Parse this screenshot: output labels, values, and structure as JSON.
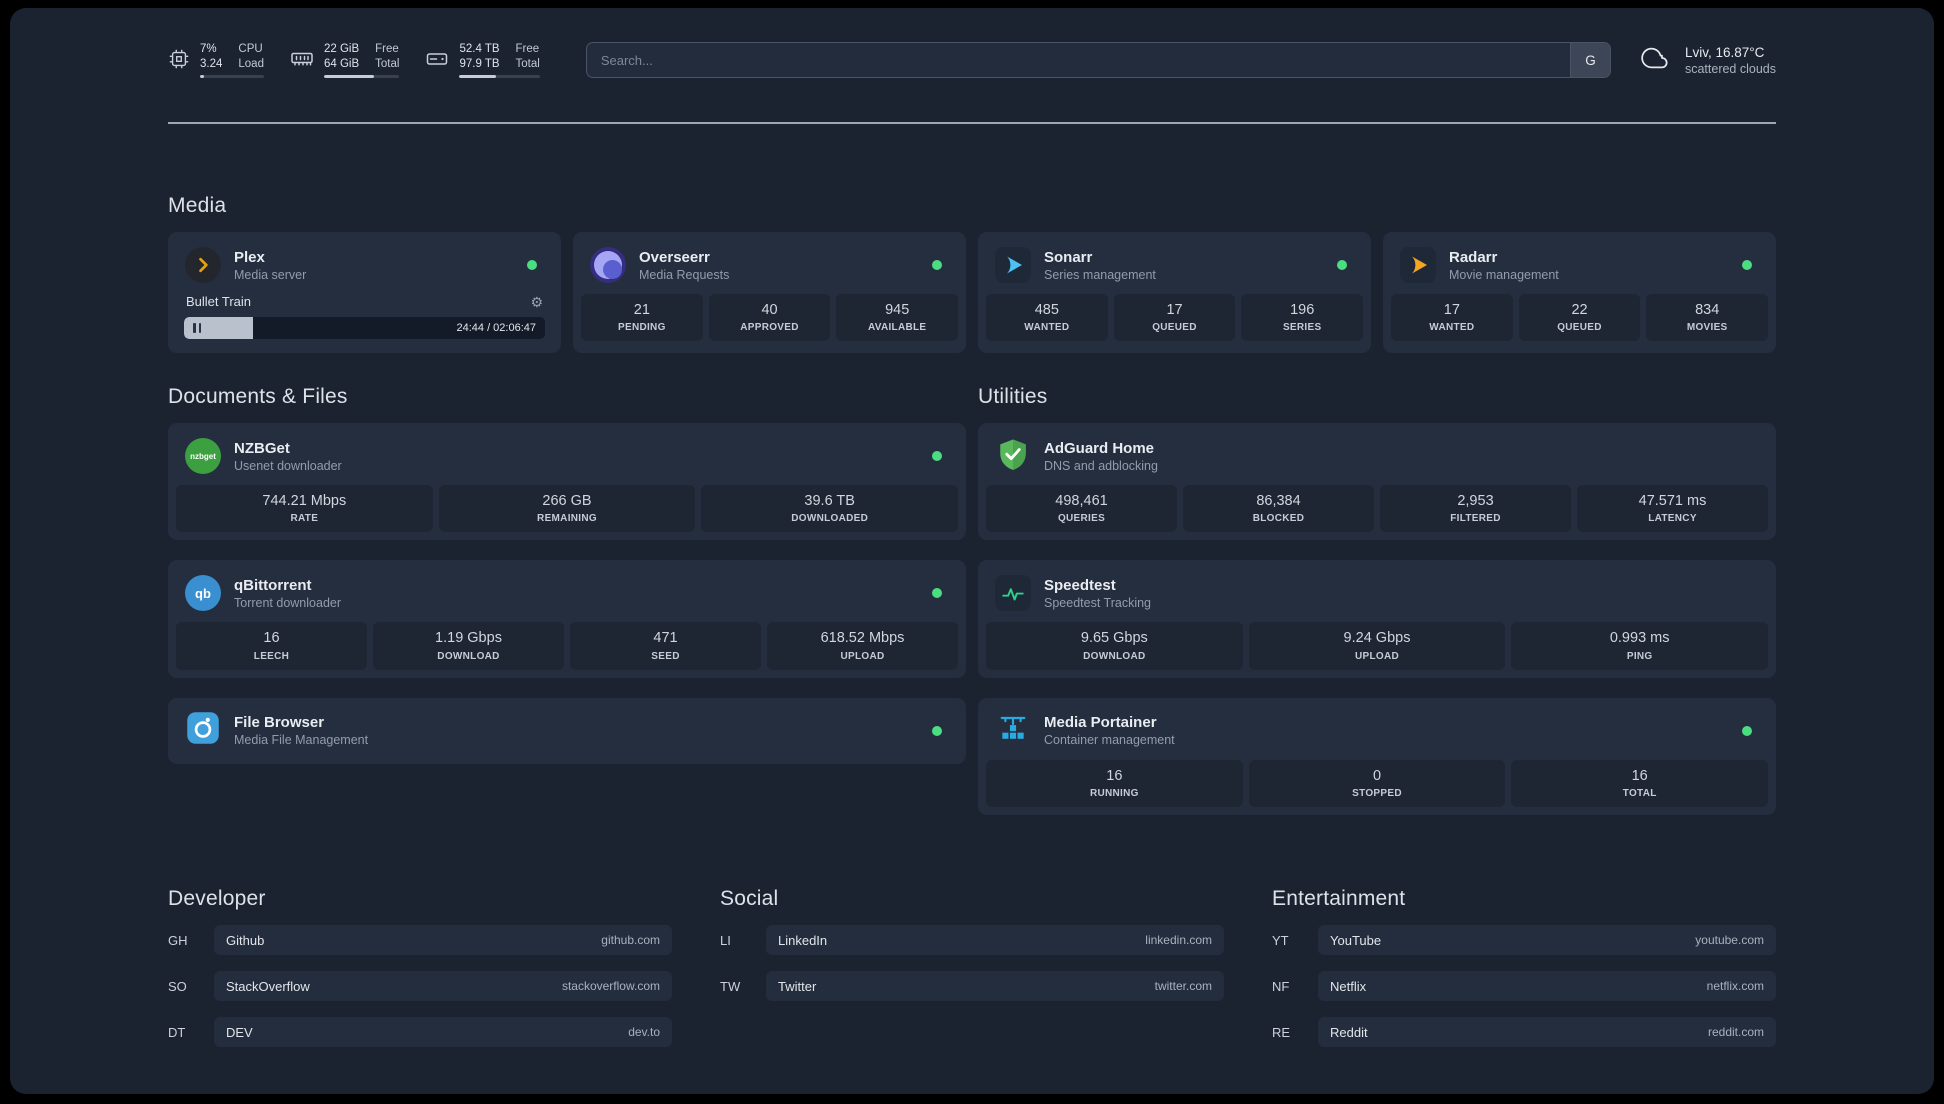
{
  "topbar": {
    "cpu": {
      "icon": "cpu-chip-icon",
      "values": [
        "7%",
        "3.24"
      ],
      "labels": [
        "CPU",
        "Load"
      ],
      "bar_pct": 7
    },
    "memory": {
      "icon": "memory-icon",
      "values": [
        "22 GiB",
        "64 GiB"
      ],
      "labels": [
        "Free",
        "Total"
      ],
      "bar_pct": 66
    },
    "disk": {
      "icon": "disk-icon",
      "values": [
        "52.4 TB",
        "97.9 TB"
      ],
      "labels": [
        "Free",
        "Total"
      ],
      "bar_pct": 46
    },
    "search": {
      "placeholder": "Search...",
      "button_label": "G"
    },
    "weather": {
      "icon": "cloud-icon",
      "location": "Lviv, 16.87°C",
      "condition": "scattered clouds"
    }
  },
  "media": {
    "heading": "Media",
    "plex": {
      "name": "Plex",
      "desc": "Media server",
      "icon": "plex-icon",
      "status": "online",
      "player": {
        "title": "Bullet Train",
        "time": "24:44 / 02:06:47",
        "progress_pct": 19
      }
    },
    "overseerr": {
      "name": "Overseerr",
      "desc": "Media Requests",
      "icon": "overseerr-icon",
      "status": "online",
      "stats": [
        {
          "value": "21",
          "label": "PENDING"
        },
        {
          "value": "40",
          "label": "APPROVED"
        },
        {
          "value": "945",
          "label": "AVAILABLE"
        }
      ]
    },
    "sonarr": {
      "name": "Sonarr",
      "desc": "Series management",
      "icon": "sonarr-icon",
      "status": "online",
      "stats": [
        {
          "value": "485",
          "label": "WANTED"
        },
        {
          "value": "17",
          "label": "QUEUED"
        },
        {
          "value": "196",
          "label": "SERIES"
        }
      ]
    },
    "radarr": {
      "name": "Radarr",
      "desc": "Movie management",
      "icon": "radarr-icon",
      "status": "online",
      "stats": [
        {
          "value": "17",
          "label": "WANTED"
        },
        {
          "value": "22",
          "label": "QUEUED"
        },
        {
          "value": "834",
          "label": "MOVIES"
        }
      ]
    }
  },
  "documents": {
    "heading": "Documents & Files",
    "nzbget": {
      "name": "NZBGet",
      "desc": "Usenet downloader",
      "icon": "nzbget-icon",
      "icon_text": "nzbget",
      "status": "online",
      "stats": [
        {
          "value": "744.21 Mbps",
          "label": "RATE"
        },
        {
          "value": "266 GB",
          "label": "REMAINING"
        },
        {
          "value": "39.6 TB",
          "label": "DOWNLOADED"
        }
      ]
    },
    "qbittorrent": {
      "name": "qBittorrent",
      "desc": "Torrent downloader",
      "icon": "qbittorrent-icon",
      "icon_text": "qb",
      "status": "online",
      "stats": [
        {
          "value": "16",
          "label": "LEECH"
        },
        {
          "value": "1.19 Gbps",
          "label": "DOWNLOAD"
        },
        {
          "value": "471",
          "label": "SEED"
        },
        {
          "value": "618.52 Mbps",
          "label": "UPLOAD"
        }
      ]
    },
    "filebrowser": {
      "name": "File Browser",
      "desc": "Media File Management",
      "icon": "filebrowser-icon",
      "status": "online"
    }
  },
  "utilities": {
    "heading": "Utilities",
    "adguard": {
      "name": "AdGuard Home",
      "desc": "DNS and adblocking",
      "icon": "adguard-shield-icon",
      "stats": [
        {
          "value": "498,461",
          "label": "QUERIES"
        },
        {
          "value": "86,384",
          "label": "BLOCKED"
        },
        {
          "value": "2,953",
          "label": "FILTERED"
        },
        {
          "value": "47.571 ms",
          "label": "LATENCY"
        }
      ]
    },
    "speedtest": {
      "name": "Speedtest",
      "desc": "Speedtest Tracking",
      "icon": "speedtest-graph-icon",
      "stats": [
        {
          "value": "9.65 Gbps",
          "label": "DOWNLOAD"
        },
        {
          "value": "9.24 Gbps",
          "label": "UPLOAD"
        },
        {
          "value": "0.993 ms",
          "label": "PING"
        }
      ]
    },
    "portainer": {
      "name": "Media Portainer",
      "desc": "Container management",
      "icon": "portainer-crane-icon",
      "status": "online",
      "stats": [
        {
          "value": "16",
          "label": "RUNNING"
        },
        {
          "value": "0",
          "label": "STOPPED"
        },
        {
          "value": "16",
          "label": "TOTAL"
        }
      ]
    }
  },
  "bookmarks": {
    "developer": {
      "heading": "Developer",
      "items": [
        {
          "abbr": "GH",
          "name": "Github",
          "url": "github.com"
        },
        {
          "abbr": "SO",
          "name": "StackOverflow",
          "url": "stackoverflow.com"
        },
        {
          "abbr": "DT",
          "name": "DEV",
          "url": "dev.to"
        }
      ]
    },
    "social": {
      "heading": "Social",
      "items": [
        {
          "abbr": "LI",
          "name": "LinkedIn",
          "url": "linkedin.com"
        },
        {
          "abbr": "TW",
          "name": "Twitter",
          "url": "twitter.com"
        }
      ]
    },
    "entertainment": {
      "heading": "Entertainment",
      "items": [
        {
          "abbr": "YT",
          "name": "YouTube",
          "url": "youtube.com"
        },
        {
          "abbr": "NF",
          "name": "Netflix",
          "url": "netflix.com"
        },
        {
          "abbr": "RE",
          "name": "Reddit",
          "url": "reddit.com"
        }
      ]
    }
  },
  "colors": {
    "status_online": "#4ade80",
    "plex_amber": "#e5a00d",
    "sonarr_blue": "#4cc2f1",
    "radarr_amber": "#f5a623",
    "nzbget_green": "#3c9f40",
    "qbittorrent_blue": "#398fd0",
    "filebrowser_blue": "#3fa0dc",
    "adguard_green": "#59b85c",
    "speedtest_green": "#2fd08c",
    "portainer_blue": "#29aae1"
  }
}
